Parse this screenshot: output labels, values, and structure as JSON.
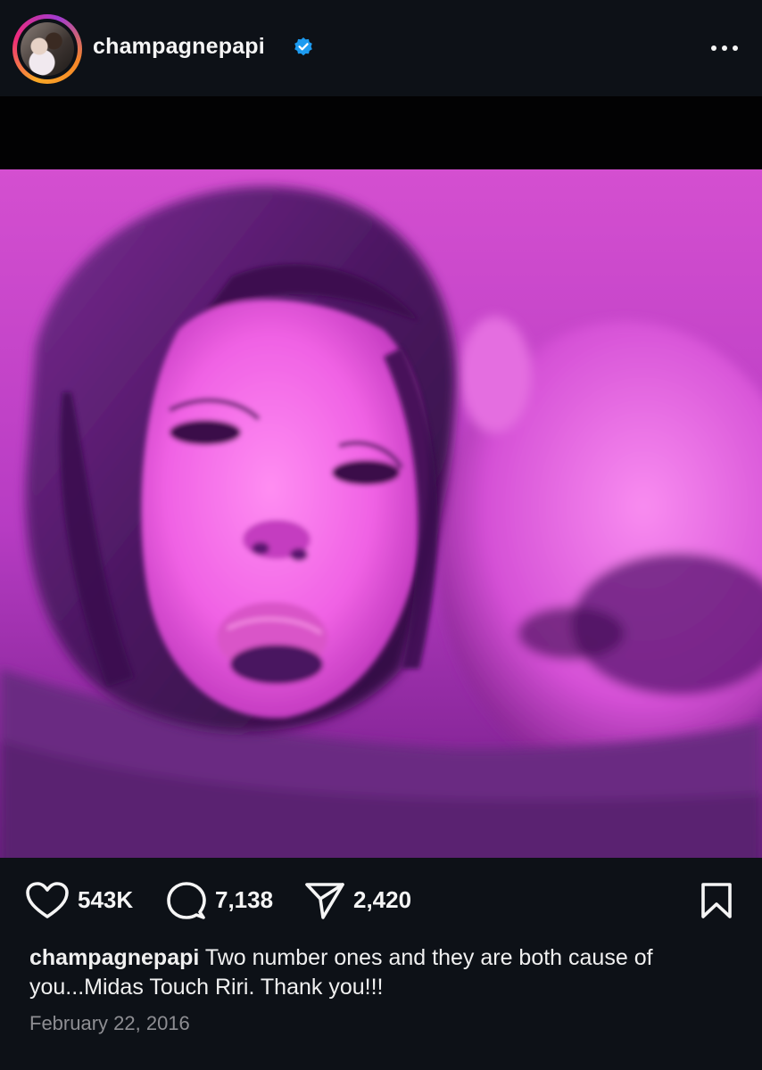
{
  "post": {
    "username": "champagnepapi",
    "verified_icon": "verified-badge-icon",
    "more_icon": "more-options-icon",
    "likes": "543K",
    "comments": "7,138",
    "shares": "2,420",
    "caption": "Two number ones and they are both cause of you...Midas Touch Riri. Thank you!!!",
    "date": "February 22, 2016"
  },
  "colors": {
    "background": "#0d1117",
    "verified": "#1d9bf0",
    "photo_tint": "#d43fcf",
    "muted_text": "#8e8e93"
  }
}
